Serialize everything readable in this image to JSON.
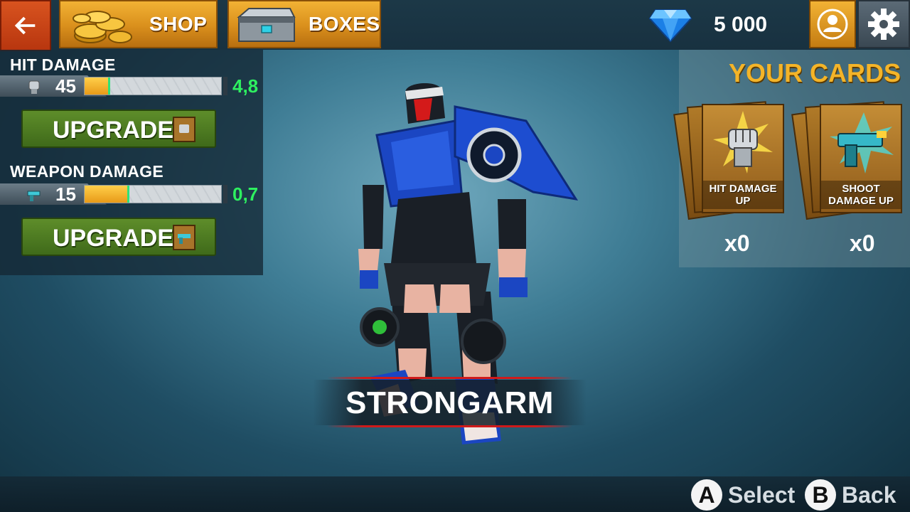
{
  "topbar": {
    "back_icon": "arrow-left-icon",
    "shop_label": "SHOP",
    "boxes_label": "BOXES",
    "gems": "5 000",
    "profile_icon": "user-icon",
    "settings_icon": "gear-icon"
  },
  "stats": {
    "hit_damage": {
      "title": "HIT DAMAGE",
      "value": "45",
      "bonus": "4,8",
      "fill": 0.19,
      "icon": "fist-icon"
    },
    "weapon_damage": {
      "title": "WEAPON DAMAGE",
      "value": "15",
      "bonus": "0,7",
      "fill": 0.33,
      "icon": "gun-icon"
    },
    "upgrade_label": "UPGRADE"
  },
  "cards": {
    "title": "YOUR CARDS",
    "items": [
      {
        "label": "HIT DAMAGE UP",
        "count": "x0",
        "icon": "fist-card-icon"
      },
      {
        "label": "SHOOT DAMAGE UP",
        "count": "x0",
        "icon": "gun-card-icon"
      }
    ]
  },
  "robot": {
    "name": "STRONGARM"
  },
  "hints": {
    "select_key": "A",
    "select_label": "Select",
    "back_key": "B",
    "back_label": "Back"
  },
  "colors": {
    "accent_orange": "#d98f1c",
    "back_red": "#c8441a",
    "upgrade_green": "#4e7d22",
    "bonus_green": "#2ef060",
    "cards_title_gold": "#f4b428"
  }
}
